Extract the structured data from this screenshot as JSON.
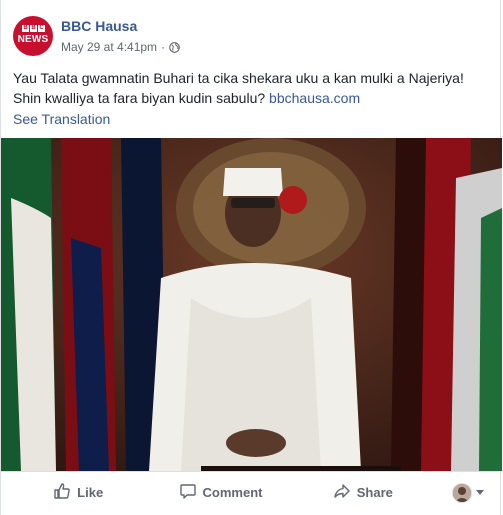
{
  "post": {
    "page_name": "BBC Hausa",
    "timestamp": "May 29 at 4:41pm",
    "separator": "·",
    "privacy_icon": "globe-icon",
    "text": "Yau Talata gwamnatin Buhari ta cika shekara uku a kan mulki a Najeriya! Shin kwalliya ta fara biyan kudin sabulu?",
    "link_text": "bbchausa.com",
    "see_translation": "See Translation"
  },
  "avatar": {
    "letters": [
      "B",
      "B",
      "C"
    ],
    "word": "NEWS",
    "brand_color": "#c8102e"
  },
  "actions": {
    "like": "Like",
    "comment": "Comment",
    "share": "Share"
  },
  "colors": {
    "link": "#385898",
    "muted": "#606770",
    "text": "#1d2129"
  }
}
